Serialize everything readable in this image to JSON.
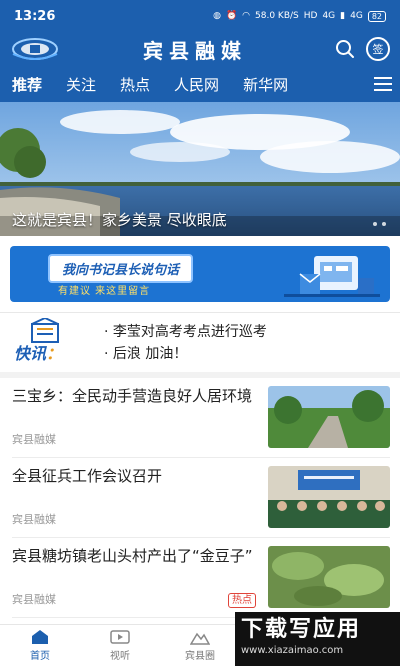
{
  "status_bar": {
    "time": "13:26",
    "speed": "58.0 KB/S",
    "network": "HD",
    "signal_1": "4G",
    "signal_2": "4G",
    "battery": "82",
    "icons": [
      "notification-icon",
      "alarm-icon",
      "wifi-icon",
      "signal-icon",
      "battery-icon"
    ]
  },
  "header": {
    "title": "宾县融媒",
    "sign_label": "签",
    "icons": [
      "logo-icon",
      "search-icon",
      "sign-in-icon"
    ]
  },
  "tabs": [
    {
      "label": "推荐",
      "active": true
    },
    {
      "label": "关注",
      "active": false
    },
    {
      "label": "热点",
      "active": false
    },
    {
      "label": "人民网",
      "active": false
    },
    {
      "label": "新华网",
      "active": false
    }
  ],
  "banner": {
    "caption": "这就是宾县！家乡美景 尽收眼底"
  },
  "promo": {
    "title": "我向书记县长说句话",
    "subtitle": "有建议 来这里留言"
  },
  "flash": {
    "label_main": "快讯",
    "label_colon": "：",
    "items": [
      "· 李莹对高考考点进行巡考",
      "· 后浪 加油！"
    ]
  },
  "news": [
    {
      "title": "三宝乡：全民动手营造良好人居环境",
      "source": "宾县融媒",
      "hot": ""
    },
    {
      "title": "全县征兵工作会议召开",
      "source": "宾县融媒",
      "hot": ""
    },
    {
      "title": "宾县糖坊镇老山头村产出了“金豆子”",
      "source": "宾县融媒",
      "hot": "热点"
    }
  ],
  "bottom_nav": [
    {
      "label": "首页",
      "icon": "home-icon",
      "active": true
    },
    {
      "label": "视听",
      "icon": "video-icon",
      "active": false
    },
    {
      "label": "宾县圈",
      "icon": "community-icon",
      "active": false
    }
  ],
  "watermark": {
    "main": "下载写应用",
    "url": "www.xiazaimao.com"
  },
  "colors": {
    "brand": "#1c5fae",
    "accent_orange": "#e79a1f",
    "hot_red": "#e0443a"
  }
}
